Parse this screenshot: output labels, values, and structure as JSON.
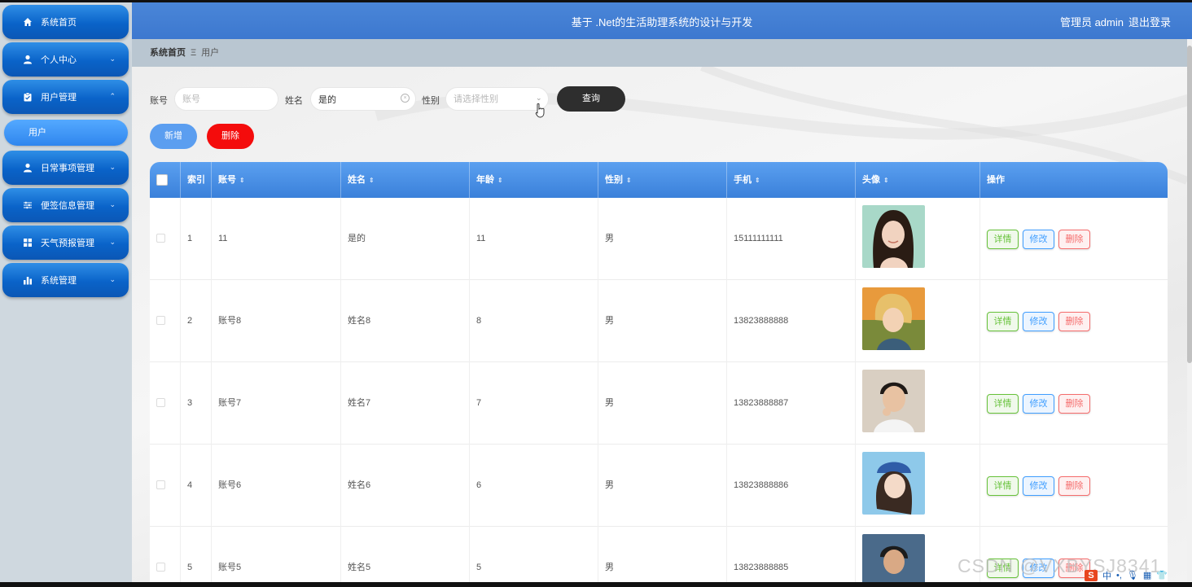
{
  "header": {
    "title": "基于 .Net的生活助理系统的设计与开发",
    "user": "管理员 admin",
    "logout": "退出登录"
  },
  "sidebar": {
    "items": [
      {
        "label": "系统首页",
        "icon": "home-icon",
        "expandable": false
      },
      {
        "label": "个人中心",
        "icon": "person-icon",
        "expandable": true
      },
      {
        "label": "用户管理",
        "icon": "clipboard-icon",
        "expandable": true,
        "expanded": true
      },
      {
        "label": "日常事项管理",
        "icon": "person-icon",
        "expandable": true
      },
      {
        "label": "便签信息管理",
        "icon": "sliders-icon",
        "expandable": true
      },
      {
        "label": "天气预报管理",
        "icon": "grid-icon",
        "expandable": true
      },
      {
        "label": "系统管理",
        "icon": "bar-chart-icon",
        "expandable": true
      }
    ],
    "sub_item": "用户"
  },
  "breadcrumb": {
    "home": "系统首页",
    "separator": "Ξ",
    "current": "用户"
  },
  "search": {
    "account_label": "账号",
    "account_placeholder": "账号",
    "account_value": "",
    "name_label": "姓名",
    "name_value": "是的",
    "gender_label": "性别",
    "gender_placeholder": "请选择性别",
    "query_button": "查询"
  },
  "actions": {
    "add": "新增",
    "delete": "删除"
  },
  "table": {
    "columns": [
      "索引",
      "账号",
      "姓名",
      "年龄",
      "性别",
      "手机",
      "头像",
      "操作"
    ],
    "rows": [
      {
        "index": "1",
        "account": "11",
        "name": "是的",
        "age": "11",
        "gender": "男",
        "phone": "15111111111"
      },
      {
        "index": "2",
        "account": "账号8",
        "name": "姓名8",
        "age": "8",
        "gender": "男",
        "phone": "13823888888"
      },
      {
        "index": "3",
        "account": "账号7",
        "name": "姓名7",
        "age": "7",
        "gender": "男",
        "phone": "13823888887"
      },
      {
        "index": "4",
        "account": "账号6",
        "name": "姓名6",
        "age": "6",
        "gender": "男",
        "phone": "13823888886"
      },
      {
        "index": "5",
        "account": "账号5",
        "name": "姓名5",
        "age": "5",
        "gender": "男",
        "phone": "13823888885"
      }
    ],
    "row_actions": {
      "detail": "详情",
      "edit": "修改",
      "delete": "删除"
    }
  },
  "watermark": "CSDN @VXBYSJ8341",
  "ime": {
    "mode": "中"
  },
  "colors": {
    "sidebar_item": "#0a63c9",
    "header": "#4a86d8",
    "table_header": "#3a80da",
    "query_button": "#2e2e2e",
    "add_button": "#5b9ef0",
    "delete_button": "#f40c0c"
  }
}
